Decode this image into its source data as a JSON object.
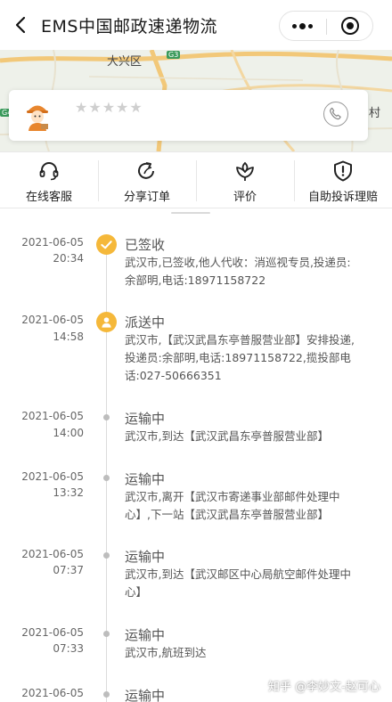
{
  "header": {
    "title": "EMS中国邮政速递物流"
  },
  "map": {
    "district_label": "大兴区",
    "road_badge_1": "G3",
    "road_badge_2": "G4",
    "corner_text": "村"
  },
  "courier": {
    "rating_stars": "★★★★★"
  },
  "actions": [
    {
      "label": "在线客服",
      "icon": "headset-icon"
    },
    {
      "label": "分享订单",
      "icon": "share-icon"
    },
    {
      "label": "评价",
      "icon": "rating-flower-icon"
    },
    {
      "label": "自助投诉理赔",
      "icon": "shield-alert-icon"
    }
  ],
  "timeline": [
    {
      "date": "2021-06-05",
      "time": "20:34",
      "status": "已签收",
      "desc": "武汉市,已签收,他人代收：消巡视专员,投递员:余部明,电话:18971158722",
      "marker": "check-icon"
    },
    {
      "date": "2021-06-05",
      "time": "14:58",
      "status": "派送中",
      "desc": "武汉市,【武汉武昌东亭普服营业部】安排投递,投递员:余部明,电话:18971158722,揽投部电话:027-50666351",
      "marker": "courier-icon"
    },
    {
      "date": "2021-06-05",
      "time": "14:00",
      "status": "运输中",
      "desc": "武汉市,到达【武汉武昌东亭普服营业部】",
      "marker": "dot"
    },
    {
      "date": "2021-06-05",
      "time": "13:32",
      "status": "运输中",
      "desc": "武汉市,离开【武汉市寄递事业部邮件处理中心】,下一站【武汉武昌东亭普服营业部】",
      "marker": "dot"
    },
    {
      "date": "2021-06-05",
      "time": "07:37",
      "status": "运输中",
      "desc": "武汉市,到达【武汉邮区中心局航空邮件处理中心】",
      "marker": "dot"
    },
    {
      "date": "2021-06-05",
      "time": "07:33",
      "status": "运输中",
      "desc": "武汉市,航班到达",
      "marker": "dot"
    },
    {
      "date": "2021-06-05",
      "time": "",
      "status": "运输中",
      "desc": "",
      "marker": "dot"
    }
  ],
  "watermark": "知乎 @李妙文-赵可心",
  "colors": {
    "accent": "#f5b83a",
    "line": "#dcdcdc"
  }
}
